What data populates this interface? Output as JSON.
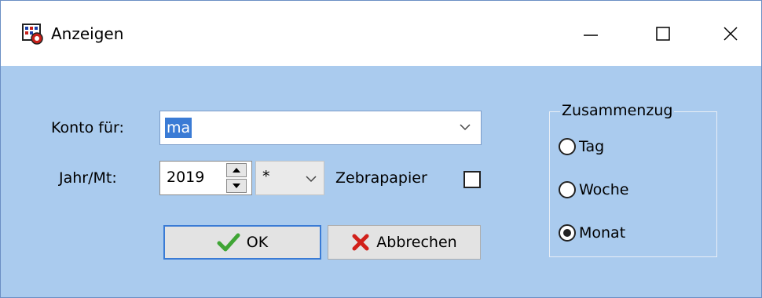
{
  "window": {
    "title": "Anzeigen"
  },
  "titlebar": {
    "buttons": [
      "minimize",
      "maximize",
      "close"
    ]
  },
  "form": {
    "konto_label": "Konto für:",
    "konto_value": "ma",
    "jahr_label": "Jahr/Mt:",
    "jahr_value": "2019",
    "monat_value": "*",
    "zebra_label": "Zebrapapier",
    "zebra_checked": false
  },
  "buttons": {
    "ok": "OK",
    "cancel": "Abbrechen"
  },
  "zusammenzug": {
    "legend": "Zusammenzug",
    "options": [
      {
        "label": "Tag",
        "checked": false
      },
      {
        "label": "Woche",
        "checked": false
      },
      {
        "label": "Monat",
        "checked": true
      }
    ]
  },
  "colors": {
    "client_bg": "#aacbee",
    "selection": "#3a7bd5",
    "ok_check": "#3fa535",
    "cancel_x": "#d1201a"
  }
}
